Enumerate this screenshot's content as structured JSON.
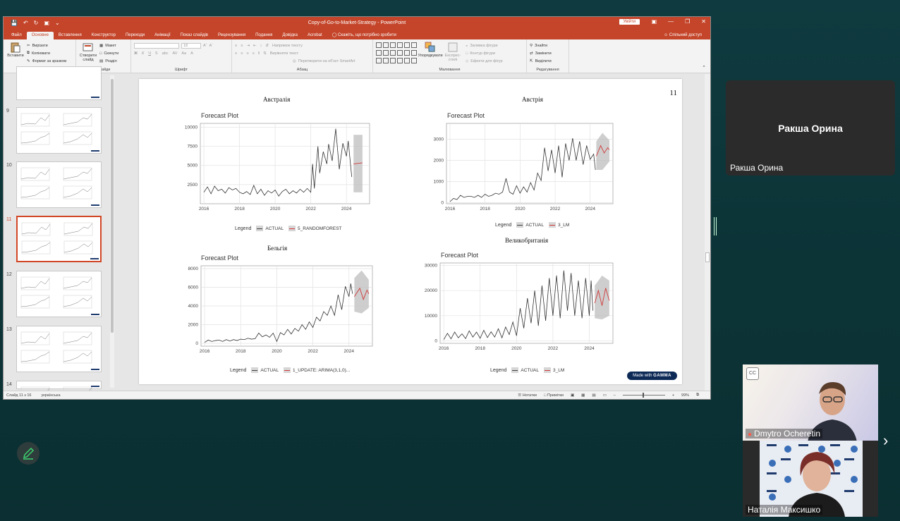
{
  "window": {
    "title": "Copy-of-Go-to-Market-Strategy  -  PowerPoint",
    "login_label": "Увійти",
    "share_label": "Спільний доступ"
  },
  "tabs": [
    "Файл",
    "Основне",
    "Вставлення",
    "Конструктор",
    "Переходи",
    "Анімації",
    "Показ слайдів",
    "Рецензування",
    "Подання",
    "Довідка",
    "Acrobat"
  ],
  "tell_me": "Скажіть, що потрібно зробити",
  "ribbon": {
    "clipboard": {
      "paste": "Вставити",
      "cut": "Вирізати",
      "copy": "Копіювати",
      "format": "Формат за зразком",
      "label": "Буфер обміну"
    },
    "slides": {
      "new": "Створити слайд",
      "layout": "Макет",
      "reset": "Скинути",
      "section": "Розділ",
      "label": "Слайди"
    },
    "font": {
      "size": "18",
      "label": "Шрифт"
    },
    "paragraph": {
      "direction": "Напрямок тексту",
      "align": "Вирівняти текст",
      "smartart": "Перетворити на об'єкт SmartArt",
      "label": "Абзац"
    },
    "drawing": {
      "arrange": "Упорядкувати",
      "quick": "Експрес-стилі",
      "fill": "Заливка фігури",
      "outline": "Контур фігури",
      "effects": "Ефекти для фігур",
      "label": "Малювання"
    },
    "editing": {
      "find": "Знайти",
      "replace": "Замінити",
      "select": "Виділити",
      "label": "Редагування"
    }
  },
  "thumbnails": [
    {
      "num": "9",
      "top": 47
    },
    {
      "num": "10",
      "top": 124
    },
    {
      "num": "11",
      "top": 201,
      "active": true
    },
    {
      "num": "12",
      "top": 279
    },
    {
      "num": "13",
      "top": 357
    },
    {
      "num": "14",
      "top": 435
    }
  ],
  "slide": {
    "number": "11",
    "gamma": "Made with",
    "gamma_brand": "GAMMA"
  },
  "chart_data": [
    {
      "type": "line",
      "country": "Австралія",
      "title": "Forecast Plot",
      "yticks": [
        2500,
        5000,
        7500,
        10000
      ],
      "ylim": [
        0,
        10500
      ],
      "xticks": [
        2016,
        2018,
        2020,
        2022,
        2024
      ],
      "xlim": [
        2015.8,
        2025.3
      ],
      "actual": [
        [
          2016,
          1500
        ],
        [
          2016.2,
          2200
        ],
        [
          2016.4,
          1300
        ],
        [
          2016.6,
          2300
        ],
        [
          2016.8,
          1700
        ],
        [
          2017,
          1900
        ],
        [
          2017.2,
          1400
        ],
        [
          2017.4,
          2100
        ],
        [
          2017.6,
          1800
        ],
        [
          2017.8,
          2000
        ],
        [
          2018,
          1500
        ],
        [
          2018.2,
          1300
        ],
        [
          2018.4,
          1600
        ],
        [
          2018.6,
          1200
        ],
        [
          2018.8,
          2400
        ],
        [
          2019,
          1300
        ],
        [
          2019.2,
          1900
        ],
        [
          2019.4,
          1100
        ],
        [
          2019.6,
          1700
        ],
        [
          2019.8,
          1400
        ],
        [
          2020,
          1800
        ],
        [
          2020.2,
          1000
        ],
        [
          2020.4,
          1600
        ],
        [
          2020.6,
          1900
        ],
        [
          2020.8,
          1300
        ],
        [
          2021,
          1700
        ],
        [
          2021.2,
          1400
        ],
        [
          2021.4,
          1900
        ],
        [
          2021.6,
          1500
        ],
        [
          2021.8,
          2000
        ],
        [
          2022,
          1500
        ],
        [
          2022.1,
          5200
        ],
        [
          2022.2,
          2000
        ],
        [
          2022.4,
          7500
        ],
        [
          2022.5,
          4000
        ],
        [
          2022.7,
          6800
        ],
        [
          2022.9,
          5200
        ],
        [
          2023,
          7800
        ],
        [
          2023.2,
          5600
        ],
        [
          2023.4,
          9800
        ],
        [
          2023.6,
          4500
        ],
        [
          2023.8,
          7900
        ],
        [
          2024,
          6200
        ],
        [
          2024.1,
          8200
        ],
        [
          2024.3,
          3500
        ]
      ],
      "forecast": [
        [
          2024.4,
          5200
        ],
        [
          2024.9,
          5350
        ]
      ],
      "band": [
        [
          2024.4,
          1500,
          9000
        ],
        [
          2024.9,
          1500,
          9000
        ]
      ],
      "legend": [
        "ACTUAL",
        "5_RANDOMFOREST"
      ],
      "legend_title": "Legend"
    },
    {
      "type": "line",
      "country": "Австрія",
      "title": "Forecast Plot",
      "yticks": [
        0,
        1000,
        2000,
        3000
      ],
      "ylim": [
        -50,
        3750
      ],
      "xticks": [
        2016,
        2018,
        2020,
        2022,
        2024
      ],
      "xlim": [
        2015.8,
        2025.3
      ],
      "actual": [
        [
          2016,
          50
        ],
        [
          2016.2,
          200
        ],
        [
          2016.4,
          150
        ],
        [
          2016.6,
          350
        ],
        [
          2016.8,
          250
        ],
        [
          2017,
          300
        ],
        [
          2017.2,
          300
        ],
        [
          2017.4,
          250
        ],
        [
          2017.6,
          350
        ],
        [
          2017.8,
          250
        ],
        [
          2018,
          400
        ],
        [
          2018.2,
          300
        ],
        [
          2018.4,
          350
        ],
        [
          2018.6,
          450
        ],
        [
          2018.8,
          400
        ],
        [
          2019,
          500
        ],
        [
          2019.2,
          1150
        ],
        [
          2019.4,
          500
        ],
        [
          2019.6,
          400
        ],
        [
          2019.8,
          800
        ],
        [
          2020,
          450
        ],
        [
          2020.2,
          750
        ],
        [
          2020.4,
          500
        ],
        [
          2020.6,
          950
        ],
        [
          2020.8,
          600
        ],
        [
          2021,
          1400
        ],
        [
          2021.2,
          1050
        ],
        [
          2021.4,
          2600
        ],
        [
          2021.6,
          1500
        ],
        [
          2021.8,
          2500
        ],
        [
          2022,
          1400
        ],
        [
          2022.2,
          2700
        ],
        [
          2022.4,
          1200
        ],
        [
          2022.6,
          2800
        ],
        [
          2022.8,
          2000
        ],
        [
          2023,
          3050
        ],
        [
          2023.2,
          2000
        ],
        [
          2023.4,
          2900
        ],
        [
          2023.6,
          1800
        ],
        [
          2023.8,
          2700
        ],
        [
          2024,
          2050
        ],
        [
          2024.2,
          2300
        ],
        [
          2024.3,
          1550
        ]
      ],
      "forecast": [
        [
          2024.35,
          2200
        ],
        [
          2024.6,
          2700
        ],
        [
          2024.8,
          2350
        ],
        [
          2025,
          2600
        ],
        [
          2025.1,
          2500
        ]
      ],
      "band": [
        [
          2024.35,
          1550,
          2900
        ],
        [
          2024.7,
          1550,
          3300
        ],
        [
          2025.1,
          1950,
          2950
        ]
      ],
      "legend": [
        "ACTUAL",
        "3_LM"
      ],
      "legend_title": "Legend"
    },
    {
      "type": "line",
      "country": "Бельгія",
      "title": "Forecast Plot",
      "yticks": [
        0,
        2000,
        4000,
        6000,
        8000
      ],
      "ylim": [
        -300,
        8300
      ],
      "xticks": [
        2016,
        2018,
        2020,
        2022,
        2024
      ],
      "xlim": [
        2015.8,
        2025.3
      ],
      "actual": [
        [
          2016,
          100
        ],
        [
          2016.2,
          350
        ],
        [
          2016.4,
          200
        ],
        [
          2016.6,
          300
        ],
        [
          2016.8,
          350
        ],
        [
          2017,
          200
        ],
        [
          2017.2,
          400
        ],
        [
          2017.4,
          250
        ],
        [
          2017.6,
          400
        ],
        [
          2017.8,
          300
        ],
        [
          2018,
          450
        ],
        [
          2018.2,
          400
        ],
        [
          2018.4,
          550
        ],
        [
          2018.6,
          450
        ],
        [
          2018.8,
          500
        ],
        [
          2019,
          1100
        ],
        [
          2019.2,
          700
        ],
        [
          2019.4,
          900
        ],
        [
          2019.6,
          650
        ],
        [
          2019.8,
          1100
        ],
        [
          2020,
          200
        ],
        [
          2020.2,
          1150
        ],
        [
          2020.4,
          900
        ],
        [
          2020.6,
          1500
        ],
        [
          2020.8,
          1000
        ],
        [
          2021,
          1600
        ],
        [
          2021.2,
          1300
        ],
        [
          2021.4,
          2000
        ],
        [
          2021.6,
          1500
        ],
        [
          2021.8,
          2300
        ],
        [
          2022,
          1700
        ],
        [
          2022.2,
          2800
        ],
        [
          2022.4,
          2400
        ],
        [
          2022.6,
          3400
        ],
        [
          2022.8,
          3000
        ],
        [
          2023,
          4000
        ],
        [
          2023.2,
          3000
        ],
        [
          2023.4,
          5200
        ],
        [
          2023.6,
          3600
        ],
        [
          2023.8,
          6100
        ],
        [
          2024,
          5000
        ],
        [
          2024.1,
          6400
        ],
        [
          2024.2,
          5300
        ]
      ],
      "forecast": [
        [
          2024.3,
          5000
        ],
        [
          2024.6,
          5900
        ],
        [
          2024.8,
          4700
        ],
        [
          2025,
          5700
        ],
        [
          2025.1,
          5300
        ]
      ],
      "band": [
        [
          2024.3,
          3400,
          7000
        ],
        [
          2024.7,
          3200,
          7800
        ],
        [
          2025.1,
          3800,
          6800
        ]
      ],
      "legend": [
        "ACTUAL",
        "1_UPDATE: ARIMA(3,1,0)..."
      ],
      "legend_title": "Legend"
    },
    {
      "type": "line",
      "country": "Великобританія",
      "title": "Forecast Plot",
      "yticks": [
        0,
        10000,
        20000,
        30000
      ],
      "ylim": [
        -1000,
        31000
      ],
      "xticks": [
        2016,
        2018,
        2020,
        2022,
        2024
      ],
      "xlim": [
        2015.8,
        2025.3
      ],
      "actual": [
        [
          2016,
          500
        ],
        [
          2016.2,
          3000
        ],
        [
          2016.4,
          800
        ],
        [
          2016.6,
          3500
        ],
        [
          2016.8,
          1200
        ],
        [
          2017,
          2800
        ],
        [
          2017.2,
          900
        ],
        [
          2017.4,
          4000
        ],
        [
          2017.6,
          1500
        ],
        [
          2017.8,
          3500
        ],
        [
          2018,
          1000
        ],
        [
          2018.2,
          4200
        ],
        [
          2018.4,
          1300
        ],
        [
          2018.6,
          3600
        ],
        [
          2018.8,
          1500
        ],
        [
          2019,
          4800
        ],
        [
          2019.2,
          1200
        ],
        [
          2019.4,
          5500
        ],
        [
          2019.6,
          2500
        ],
        [
          2019.8,
          7500
        ],
        [
          2020,
          2000
        ],
        [
          2020.2,
          13000
        ],
        [
          2020.4,
          5000
        ],
        [
          2020.6,
          17000
        ],
        [
          2020.8,
          7000
        ],
        [
          2021,
          20000
        ],
        [
          2021.2,
          6000
        ],
        [
          2021.4,
          22000
        ],
        [
          2021.6,
          8000
        ],
        [
          2021.8,
          25000
        ],
        [
          2022,
          10000
        ],
        [
          2022.2,
          26000
        ],
        [
          2022.4,
          9000
        ],
        [
          2022.6,
          28000
        ],
        [
          2022.8,
          12000
        ],
        [
          2023,
          27000
        ],
        [
          2023.2,
          10000
        ],
        [
          2023.4,
          24000
        ],
        [
          2023.6,
          9000
        ],
        [
          2023.8,
          25000
        ],
        [
          2024,
          10000
        ],
        [
          2024.1,
          24000
        ],
        [
          2024.2,
          12000
        ]
      ],
      "forecast": [
        [
          2024.3,
          15000
        ],
        [
          2024.5,
          20000
        ],
        [
          2024.7,
          14000
        ],
        [
          2024.9,
          21000
        ],
        [
          2025.1,
          16000
        ]
      ],
      "band": [
        [
          2024.3,
          9000,
          22000
        ],
        [
          2024.7,
          8500,
          26000
        ],
        [
          2025.1,
          10000,
          24000
        ]
      ],
      "legend": [
        "ACTUAL",
        "3_LM"
      ],
      "legend_title": "Legend"
    }
  ],
  "status": {
    "slide": "Слайд 11 з 16",
    "lang": "українська",
    "notes": "Нотатки",
    "comments": "Примітки",
    "zoom": "99%"
  },
  "participants": {
    "main": "Ракша Орина",
    "caption": "Ракша Орина",
    "p1": "Dmytro Ocheretin",
    "p2": "Наталія Максишко"
  }
}
